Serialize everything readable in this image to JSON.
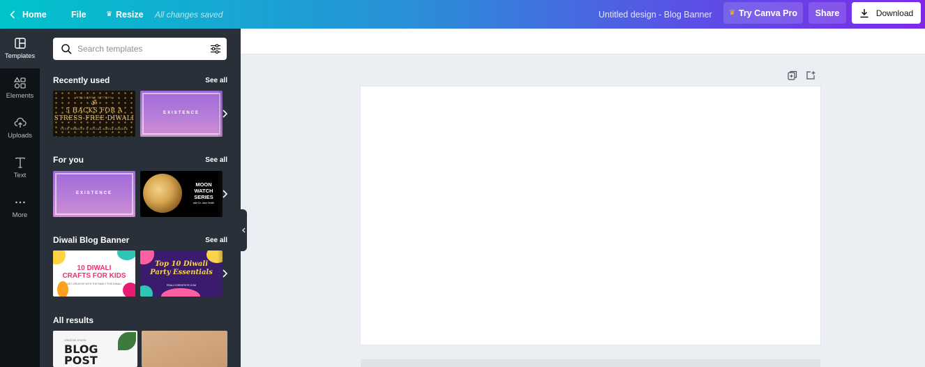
{
  "topbar": {
    "home_label": "Home",
    "file_label": "File",
    "resize_label": "Resize",
    "saved_status": "All changes saved",
    "document_title": "Untitled design - Blog Banner",
    "pro_label": "Try Canva Pro",
    "share_label": "Share",
    "download_label": "Download"
  },
  "rail": {
    "items": [
      {
        "label": "Templates",
        "icon": "templates-icon"
      },
      {
        "label": "Elements",
        "icon": "elements-icon"
      },
      {
        "label": "Uploads",
        "icon": "uploads-icon"
      },
      {
        "label": "Text",
        "icon": "text-icon"
      },
      {
        "label": "More",
        "icon": "more-icon"
      }
    ]
  },
  "panel": {
    "search_placeholder": "Search templates",
    "sections": [
      {
        "title": "Recently used",
        "link": "See all"
      },
      {
        "title": "For you",
        "link": "See all"
      },
      {
        "title": "Diwali Blog Banner",
        "link": "See all"
      },
      {
        "title": "All results"
      }
    ],
    "thumbs": {
      "diwali_hacks": {
        "kicker": "WELLNESS STUDIO",
        "line1": "5 HACKS FOR A",
        "line2": "STRESS-FREE DIWALI",
        "footer": "YOUR WEBSITE & SOCIAL MEDIA HANDLE"
      },
      "existence": {
        "word": "EXISTENCE"
      },
      "moon": {
        "line1": "MOON",
        "line2": "WATCH",
        "line3": "SERIES",
        "footer": "with Dr. Jane Smith"
      },
      "crafts": {
        "line1": "10 DIWALI",
        "line2": "CRAFTS FOR KIDS",
        "sub": "GET CREATIVE WITH THE FAMILY THIS DIWALI"
      },
      "party": {
        "line1": "Top 10 Diwali",
        "line2": "Party Essentials",
        "sub": "REALLYGREATSITE.COM"
      },
      "blog": {
        "kicker": "CREATIVE STUDIO",
        "line1": "BLOG",
        "line2": "POST"
      }
    }
  },
  "colors": {
    "brand_gradient_start": "#00c4cc",
    "brand_gradient_end": "#7d2ae8",
    "panel_bg": "#293039",
    "rail_bg": "#0e1318",
    "canvas_bg": "#ebeef2",
    "pro_crown": "#ffc107"
  }
}
